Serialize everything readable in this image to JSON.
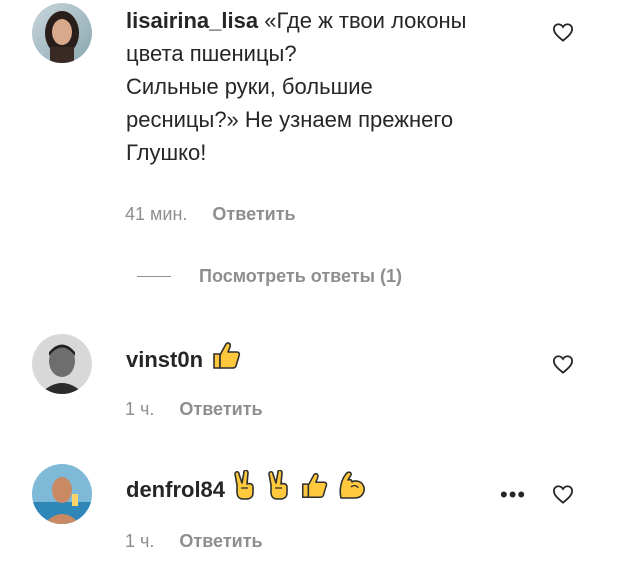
{
  "comments": [
    {
      "username": "lisairina_lisa",
      "text_lines": [
        "«Где ж твои локоны",
        "цвета пшеницы?",
        "Сильные руки, большие",
        "ресницы?» Не узнаем прежнего",
        "Глушко!"
      ],
      "time": "41 мин.",
      "reply_label": "Ответить",
      "view_replies": "Посмотреть ответы (1)"
    },
    {
      "username": "vinst0n",
      "emojis": [
        "thumbs-up-icon"
      ],
      "time": "1 ч.",
      "reply_label": "Ответить"
    },
    {
      "username": "denfrol84",
      "emojis": [
        "victory-hand-icon",
        "victory-hand-icon",
        "thumbs-up-icon",
        "flexed-biceps-icon"
      ],
      "time": "1 ч.",
      "reply_label": "Ответить",
      "more_label": "•••"
    }
  ],
  "colors": {
    "emoji_yellow": "#ffc83d",
    "emoji_outline": "#2f2f2f",
    "meta_gray": "#8e8e8e",
    "text": "#262626"
  }
}
